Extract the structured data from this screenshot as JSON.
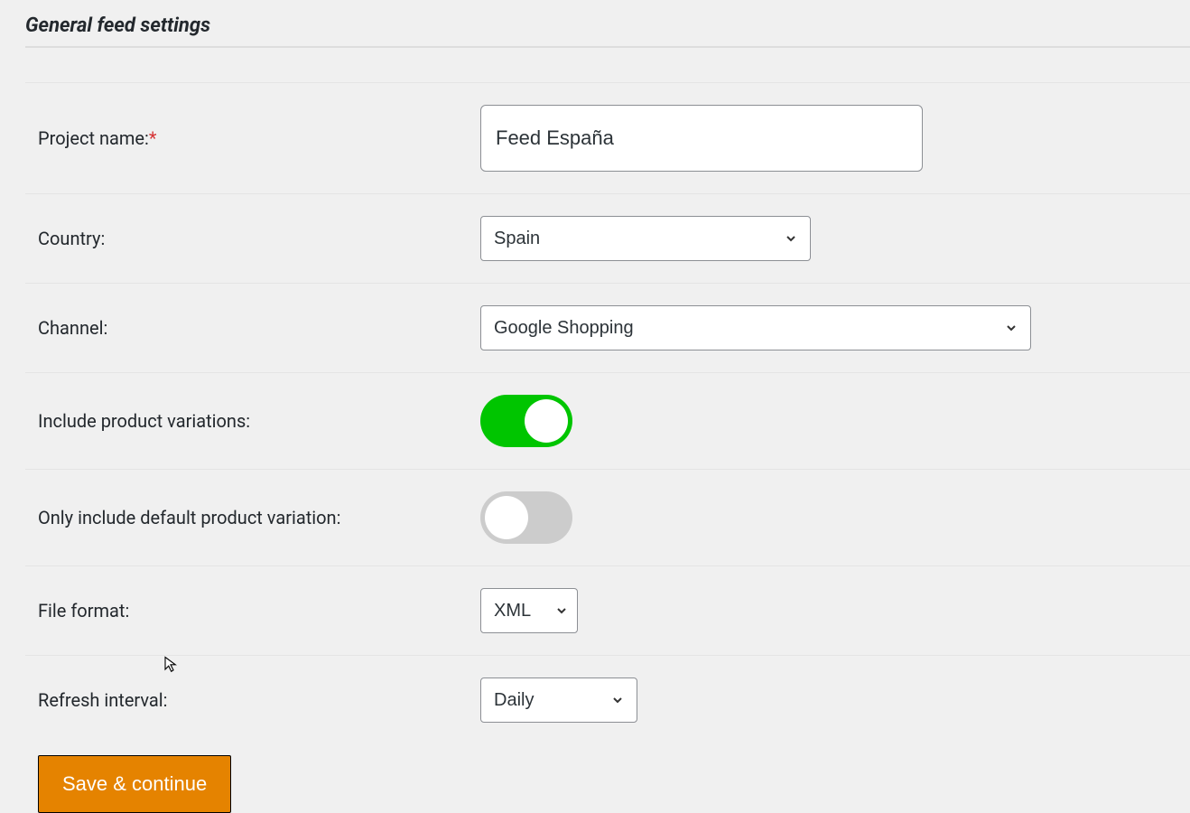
{
  "section_title": "General feed settings",
  "fields": {
    "project_name": {
      "label": "Project name:",
      "required": "*",
      "value": "Feed España"
    },
    "country": {
      "label": "Country:",
      "value": "Spain"
    },
    "channel": {
      "label": "Channel:",
      "value": "Google Shopping"
    },
    "include_variations": {
      "label": "Include product variations:",
      "on": true
    },
    "only_default_variation": {
      "label": "Only include default product variation:",
      "on": false
    },
    "file_format": {
      "label": "File format:",
      "value": "XML"
    },
    "refresh_interval": {
      "label": "Refresh interval:",
      "value": "Daily"
    }
  },
  "buttons": {
    "save": "Save & continue"
  }
}
